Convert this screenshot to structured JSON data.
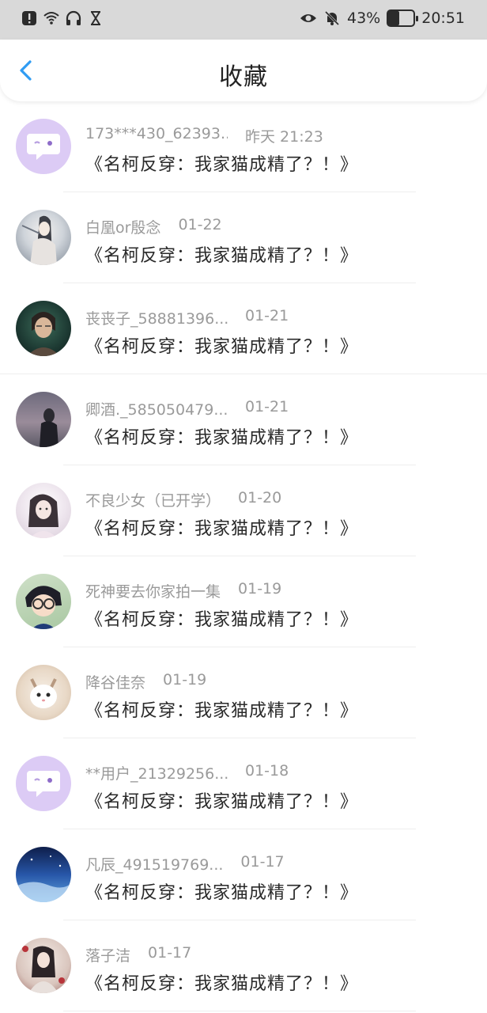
{
  "status": {
    "battery": "43%",
    "time": "20:51"
  },
  "header": {
    "title": "收藏"
  },
  "items": [
    {
      "name": "173***430_62393...",
      "date": "昨天 21:23",
      "book": "《名柯反穿：我家猫成精了？！》",
      "avatar": "default"
    },
    {
      "name": "白凰or殷念",
      "date": "01-22",
      "book": "《名柯反穿：我家猫成精了？！》",
      "avatar": "photo"
    },
    {
      "name": "丧丧子_58881396...",
      "date": "01-21",
      "book": "《名柯反穿：我家猫成精了？！》",
      "avatar": "photo"
    },
    {
      "name": "卿酒._585050479...",
      "date": "01-21",
      "book": "《名柯反穿：我家猫成精了？！》",
      "avatar": "photo"
    },
    {
      "name": "不良少女（已开学）",
      "date": "01-20",
      "book": "《名柯反穿：我家猫成精了？！》",
      "avatar": "photo"
    },
    {
      "name": "死神要去你家拍一集",
      "date": "01-19",
      "book": "《名柯反穿：我家猫成精了？！》",
      "avatar": "photo"
    },
    {
      "name": "降谷佳奈",
      "date": "01-19",
      "book": "《名柯反穿：我家猫成精了？！》",
      "avatar": "photo"
    },
    {
      "name": "**用户_21329256...",
      "date": "01-18",
      "book": "《名柯反穿：我家猫成精了？！》",
      "avatar": "default"
    },
    {
      "name": "凡辰_491519769...",
      "date": "01-17",
      "book": "《名柯反穿：我家猫成精了？！》",
      "avatar": "photo"
    },
    {
      "name": "落子洁",
      "date": "01-17",
      "book": "《名柯反穿：我家猫成精了？！》",
      "avatar": "photo"
    }
  ],
  "colors": {
    "accent": "#2f9cf3",
    "default_avatar_bg": "#dccbf5"
  },
  "icons": [
    "alert-icon",
    "wifi-icon",
    "headphones-icon",
    "hourglass-icon",
    "eye-icon",
    "bell-off-icon",
    "battery-icon",
    "back-arrow-icon",
    "chat-bubble-icon"
  ]
}
